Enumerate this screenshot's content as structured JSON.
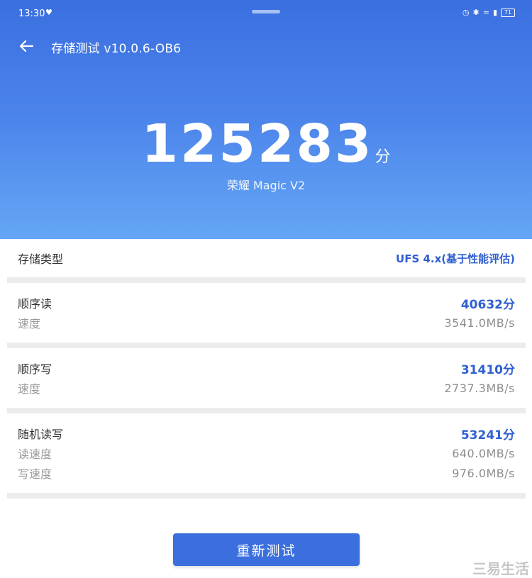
{
  "status": {
    "time": "13:30",
    "battery": "71"
  },
  "header": {
    "title": "存储测试 v10.0.6-OB6",
    "score": "125283",
    "score_unit": "分",
    "device": "荣耀 Magic V2"
  },
  "storage_type": {
    "label": "存储类型",
    "value": "UFS 4.x(基于性能评估)"
  },
  "sections": [
    {
      "title": "顺序读",
      "score": "40632分",
      "rows": [
        {
          "label": "速度",
          "value": "3541.0MB/s"
        }
      ]
    },
    {
      "title": "顺序写",
      "score": "31410分",
      "rows": [
        {
          "label": "速度",
          "value": "2737.3MB/s"
        }
      ]
    },
    {
      "title": "随机读写",
      "score": "53241分",
      "rows": [
        {
          "label": "读速度",
          "value": "640.0MB/s"
        },
        {
          "label": "写速度",
          "value": "976.0MB/s"
        }
      ]
    }
  ],
  "actions": {
    "retest_label": "重新测试"
  },
  "watermark": "三易生活",
  "colors": {
    "accent": "#2f5fd0",
    "header_top": "#3b6fe0",
    "header_bottom": "#64a6f5",
    "button": "#3a6fdd"
  }
}
